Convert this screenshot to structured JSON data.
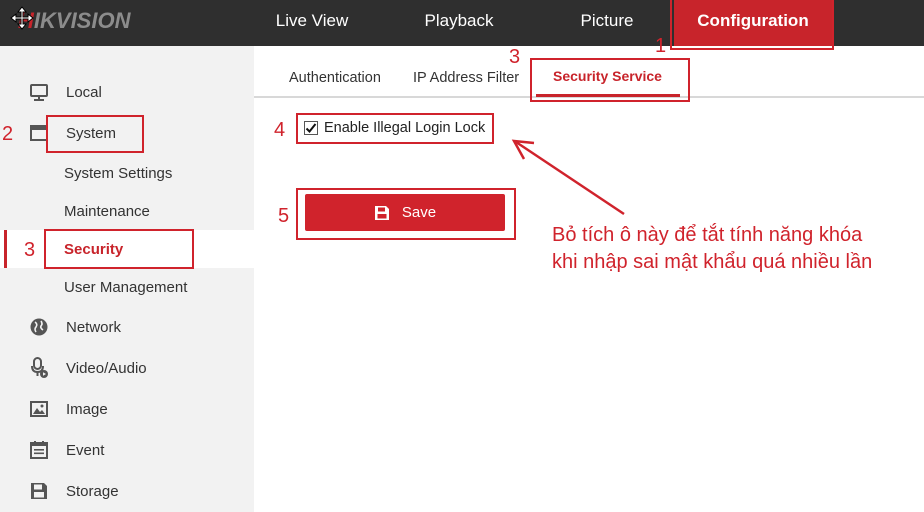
{
  "header": {
    "logo": {
      "prefix": "H",
      "rest": "IKVISION"
    },
    "tabs": [
      {
        "label": "Live View"
      },
      {
        "label": "Playback"
      },
      {
        "label": "Picture"
      },
      {
        "label": "Configuration",
        "active": true
      }
    ]
  },
  "sidebar": {
    "items": [
      {
        "label": "Local",
        "icon": "monitor-icon"
      },
      {
        "label": "System",
        "icon": "window-icon"
      },
      {
        "label": "System Settings",
        "sub": true
      },
      {
        "label": "Maintenance",
        "sub": true
      },
      {
        "label": "Security",
        "sub": true,
        "active": true
      },
      {
        "label": "User Management",
        "sub": true
      },
      {
        "label": "Network",
        "icon": "globe-icon"
      },
      {
        "label": "Video/Audio",
        "icon": "microphone-icon"
      },
      {
        "label": "Image",
        "icon": "image-icon"
      },
      {
        "label": "Event",
        "icon": "calendar-icon"
      },
      {
        "label": "Storage",
        "icon": "floppy-disk-icon"
      }
    ]
  },
  "content": {
    "subtabs": [
      {
        "label": "Authentication"
      },
      {
        "label": "IP Address Filter"
      },
      {
        "label": "Security Service",
        "active": true
      }
    ],
    "checkbox": {
      "label": "Enable Illegal Login Lock",
      "checked": true
    },
    "save_label": "Save"
  },
  "annotations": {
    "steps": [
      "1",
      "2",
      "3",
      "3",
      "4",
      "5"
    ],
    "note_line1": "Bỏ tích ô này để tắt tính năng khóa",
    "note_line2": "khi nhập sai mật khẩu quá nhiều lần"
  },
  "colors": {
    "accent": "#c8242b",
    "topbar": "#2f2f2f",
    "sidebar": "#f2f2f2",
    "logo_gray": "#8c8c8c"
  }
}
